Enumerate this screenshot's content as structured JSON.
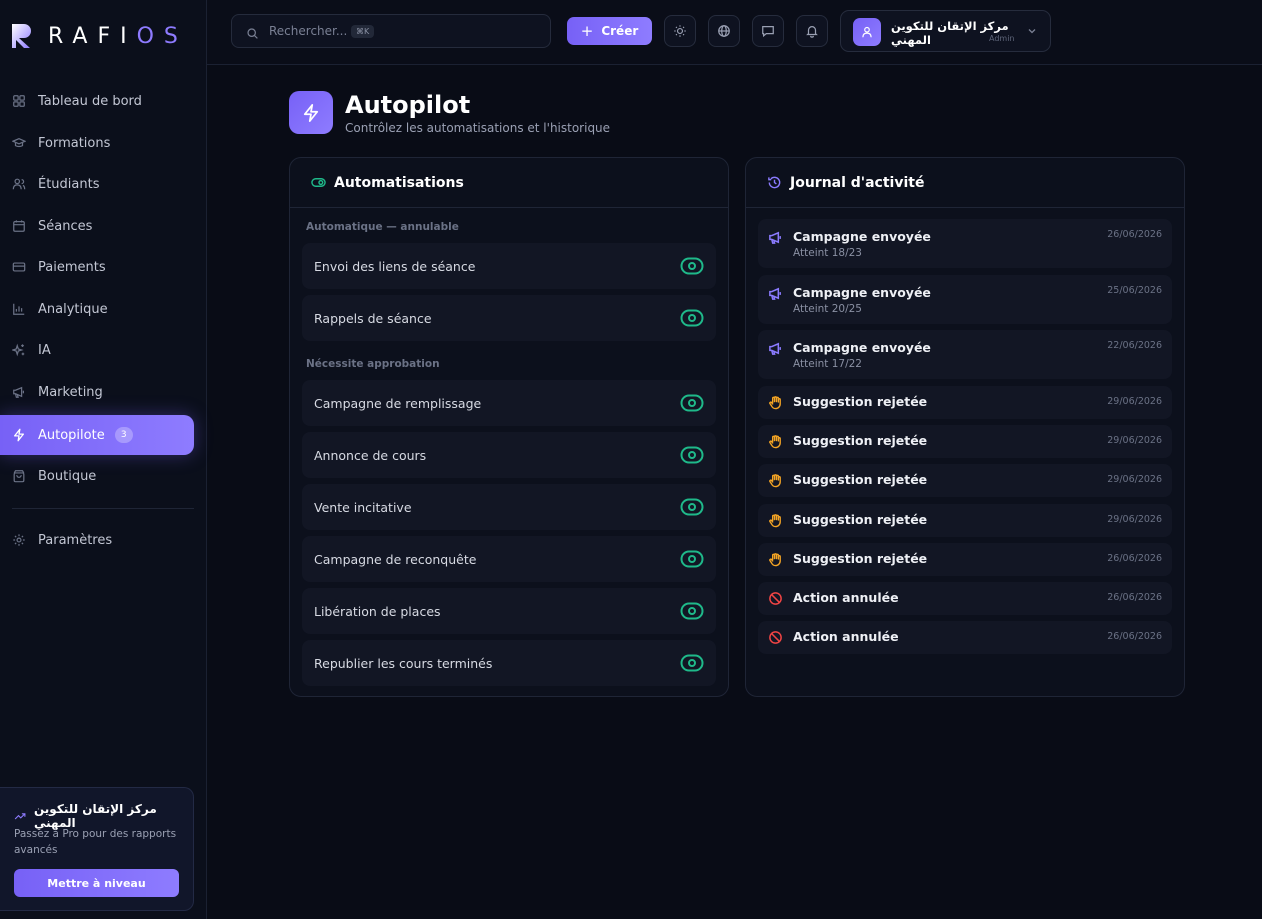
{
  "brand": {
    "logo_main": "RAFI",
    "logo_accent": "OS"
  },
  "sidebar": {
    "items": [
      {
        "label": "Tableau de bord",
        "icon": "dashboard-icon"
      },
      {
        "label": "Formations",
        "icon": "graduation-cap-icon"
      },
      {
        "label": "Étudiants",
        "icon": "users-icon"
      },
      {
        "label": "Séances",
        "icon": "calendar-icon"
      },
      {
        "label": "Paiements",
        "icon": "credit-card-icon"
      },
      {
        "label": "Analytique",
        "icon": "bar-chart-icon"
      },
      {
        "label": "IA",
        "icon": "sparkles-icon"
      },
      {
        "label": "Marketing",
        "icon": "megaphone-icon"
      },
      {
        "label": "Autopilote",
        "icon": "zap-icon",
        "badge": "3",
        "active": true
      },
      {
        "label": "Boutique",
        "icon": "shopping-bag-icon"
      },
      {
        "label": "Paramètres",
        "icon": "settings-icon"
      }
    ],
    "promo": {
      "title": "مركز الإتقان للتكوين المهني",
      "text": "Passez à Pro pour des rapports avancés",
      "button": "Mettre à niveau"
    }
  },
  "topbar": {
    "search_placeholder": "Rechercher...",
    "search_shortcut": "⌘K",
    "create_label": "Créer",
    "profile_name": "مركز الإتقان للتكوين المهني",
    "profile_role": "Admin"
  },
  "page": {
    "title": "Autopilot",
    "subtitle": "Contrôlez les automatisations et l'historique"
  },
  "automations": {
    "title": "Automatisations",
    "section_auto": "Automatique — annulable",
    "section_approval": "Nécessite approbation",
    "auto_items": [
      "Envoi des liens de séance",
      "Rappels de séance"
    ],
    "approval_items": [
      "Campagne de remplissage",
      "Annonce de cours",
      "Vente incitative",
      "Campagne de reconquête",
      "Libération de places",
      "Republier les cours terminés"
    ]
  },
  "activity": {
    "title": "Journal d'activité",
    "entries": [
      {
        "title": "Campagne envoyée",
        "sub": "Atteint 18/23",
        "date": "26/06/2026",
        "icon": "megaphone-icon"
      },
      {
        "title": "Campagne envoyée",
        "sub": "Atteint 20/25",
        "date": "25/06/2026",
        "icon": "megaphone-icon"
      },
      {
        "title": "Campagne envoyée",
        "sub": "Atteint 17/22",
        "date": "22/06/2026",
        "icon": "megaphone-icon"
      },
      {
        "title": "Suggestion rejetée",
        "date": "29/06/2026",
        "icon": "hand-icon"
      },
      {
        "title": "Suggestion rejetée",
        "date": "29/06/2026",
        "icon": "hand-icon"
      },
      {
        "title": "Suggestion rejetée",
        "date": "29/06/2026",
        "icon": "hand-icon"
      },
      {
        "title": "Suggestion rejetée",
        "date": "29/06/2026",
        "icon": "hand-icon"
      },
      {
        "title": "Suggestion rejetée",
        "date": "26/06/2026",
        "icon": "hand-icon"
      },
      {
        "title": "Action annulée",
        "date": "26/06/2026",
        "icon": "ban-icon"
      },
      {
        "title": "Action annulée",
        "date": "26/06/2026",
        "icon": "ban-icon"
      }
    ]
  },
  "colors": {
    "accent": "#7c66f8",
    "toggle_on": "#1fb98a",
    "campaign_icon": "#8b7bff",
    "suggestion_icon": "#f5a524",
    "cancel_icon": "#ef4444"
  }
}
